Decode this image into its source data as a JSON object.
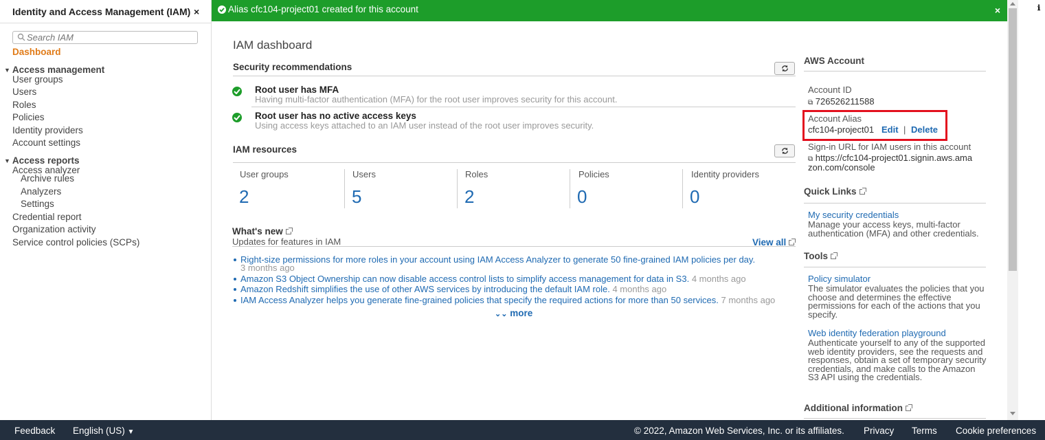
{
  "sidebar": {
    "header": "Identity and Access Management (IAM)",
    "close": "×",
    "search_placeholder": "Search IAM",
    "dashboard": "Dashboard",
    "groups": [
      {
        "label": "Access management",
        "items": [
          "User groups",
          "Users",
          "Roles",
          "Policies",
          "Identity providers",
          "Account settings"
        ]
      },
      {
        "label": "Access reports",
        "items": [
          "Access analyzer",
          "Archive rules",
          "Analyzers",
          "Settings",
          "Credential report",
          "Organization activity",
          "Service control policies (SCPs)"
        ]
      }
    ]
  },
  "flash": {
    "message": "Alias cfc104-project01 created for this account",
    "close": "×",
    "color": "#1d9d2a"
  },
  "main": {
    "title": "IAM dashboard",
    "security": {
      "title": "Security recommendations",
      "items": [
        {
          "title": "Root user has MFA",
          "desc": "Having multi-factor authentication (MFA) for the root user improves security for this account."
        },
        {
          "title": "Root user has no active access keys",
          "desc": "Using access keys attached to an IAM user instead of the root user improves security."
        }
      ]
    },
    "resources": {
      "title": "IAM resources",
      "items": [
        {
          "label": "User groups",
          "value": "2"
        },
        {
          "label": "Users",
          "value": "5"
        },
        {
          "label": "Roles",
          "value": "2"
        },
        {
          "label": "Policies",
          "value": "0"
        },
        {
          "label": "Identity providers",
          "value": "0"
        }
      ]
    },
    "whats_new": {
      "title": "What's new",
      "subtitle": "Updates for features in IAM",
      "view_all": "View all",
      "items": [
        {
          "text": "Right-size permissions for more roles in your account using IAM Access Analyzer to generate 50 fine-grained IAM policies per day.",
          "age": "3 months ago"
        },
        {
          "text": "Amazon S3 Object Ownership can now disable access control lists to simplify access management for data in S3.",
          "age": "4 months ago"
        },
        {
          "text": "Amazon Redshift simplifies the use of other AWS services by introducing the default IAM role.",
          "age": "4 months ago"
        },
        {
          "text": "IAM Access Analyzer helps you generate fine-grained policies that specify the required actions for more than 50 services.",
          "age": "7 months ago"
        }
      ],
      "more": "more"
    }
  },
  "aws_account": {
    "title": "AWS Account",
    "account_id_label": "Account ID",
    "account_id": "726526211588",
    "alias_label": "Account Alias",
    "alias": "cfc104-project01",
    "edit": "Edit",
    "sep": "|",
    "delete": "Delete",
    "signin_label": "Sign-in URL for IAM users in this account",
    "signin_url_1": "https://cfc104-project01.signin.aws.ama",
    "signin_url_2": "zon.com/console"
  },
  "quick_links": {
    "title": "Quick Links",
    "link": "My security credentials",
    "desc": "Manage your access keys, multi-factor authentication (MFA) and other credentials."
  },
  "tools": {
    "title": "Tools",
    "items": [
      {
        "link": "Policy simulator",
        "desc": "The simulator evaluates the policies that you choose and determines the effective permissions for each of the actions that you specify."
      },
      {
        "link": "Web identity federation playground",
        "desc": "Authenticate yourself to any of the supported web identity providers, see the requests and responses, obtain a set of temporary security credentials, and make calls to the Amazon S3 API using the credentials."
      }
    ]
  },
  "additional_info": {
    "title": "Additional information"
  },
  "footer": {
    "feedback": "Feedback",
    "language": "English (US)",
    "copyright": "© 2022, Amazon Web Services, Inc. or its affiliates.",
    "privacy": "Privacy",
    "terms": "Terms",
    "cookies": "Cookie preferences"
  }
}
